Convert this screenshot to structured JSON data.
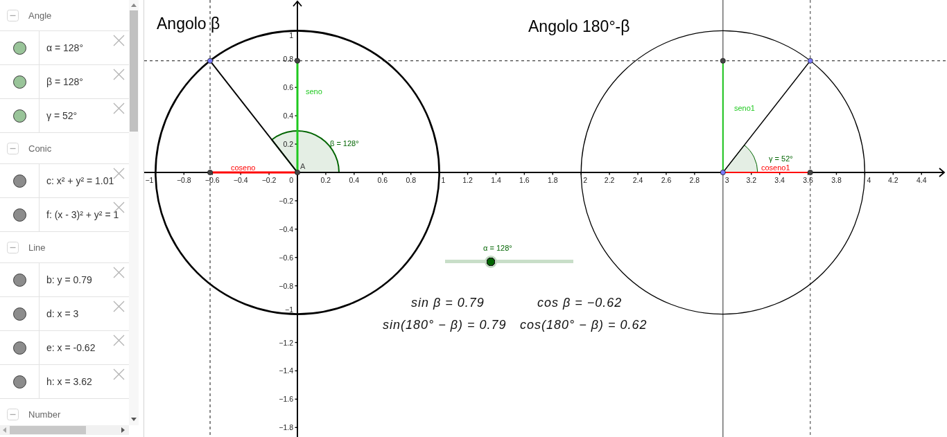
{
  "algebra_view": {
    "groups": [
      {
        "label": "Angle",
        "expanded": true,
        "items": [
          {
            "text": "α = 128°",
            "color": "#99c499",
            "visible": true
          },
          {
            "text": "β = 128°",
            "color": "#99c499",
            "visible": true
          },
          {
            "text": "γ = 52°",
            "color": "#99c499",
            "visible": true
          }
        ]
      },
      {
        "label": "Conic",
        "expanded": true,
        "items": [
          {
            "text": "c: x² + y² = 1.01",
            "color": "#8c8c8c",
            "visible": true
          },
          {
            "text": "f: (x - 3)² + y² = 1",
            "color": "#8c8c8c",
            "visible": true
          }
        ]
      },
      {
        "label": "Line",
        "expanded": true,
        "items": [
          {
            "text": "b: y = 0.79",
            "color": "#8c8c8c",
            "visible": true
          },
          {
            "text": "d: x = 3",
            "color": "#8c8c8c",
            "visible": true
          },
          {
            "text": "e: x = -0.62",
            "color": "#8c8c8c",
            "visible": true
          },
          {
            "text": "h: x = 3.62",
            "color": "#8c8c8c",
            "visible": true
          }
        ]
      },
      {
        "label": "Number",
        "expanded": true
      }
    ]
  },
  "graphics_view": {
    "left_figure": {
      "title": "Angolo β",
      "angle_label": "β = 128°",
      "sine_label": "seno",
      "cosine_label": "coseno",
      "center_label": "A"
    },
    "right_figure": {
      "title": "Angolo 180°-β",
      "angle_label": "γ = 52°",
      "sine_label": "seno1",
      "cosine_label": "coseno1"
    },
    "x_axis_labels": [
      "−1",
      "−0.8",
      "−0.6",
      "−0.4",
      "−0.2",
      "0",
      "0.2",
      "0.4",
      "0.6",
      "0.8",
      "1",
      "1.2",
      "1.4",
      "1.6",
      "1.8",
      "2",
      "2.2",
      "2.4",
      "2.6",
      "2.8",
      "3",
      "3.2",
      "3.4",
      "3.6",
      "3.8",
      "4",
      "4.2",
      "4.4"
    ],
    "y_axis_labels": [
      "1",
      "0.8",
      "0.6",
      "0.4",
      "0.2",
      "−0.2",
      "−0.4",
      "−0.6",
      "−0.8",
      "−1",
      "−1.2",
      "−1.4",
      "−1.6",
      "−1.8"
    ],
    "slider": {
      "label": "α = 128°",
      "level": 0.356
    },
    "formulas": [
      "sin β = 0.79",
      "cos β = −0.62",
      "sin(180° − β) = 0.79",
      "cos(180° − β) = 0.62"
    ]
  }
}
